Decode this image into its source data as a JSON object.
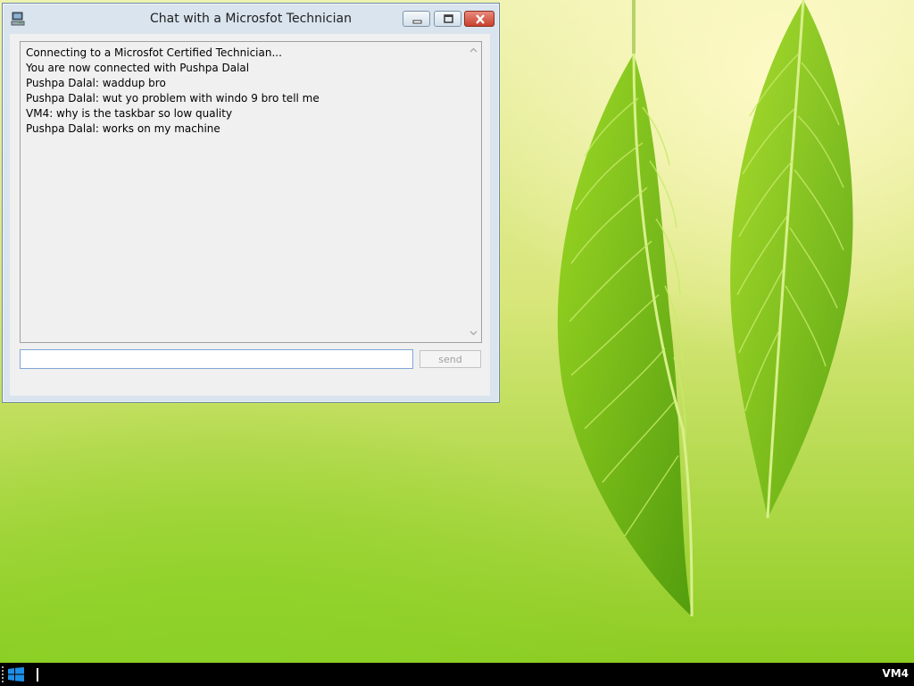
{
  "window": {
    "title": "Chat with a Microsfot Technician"
  },
  "chat": {
    "lines": [
      "Connecting to a Microsfot Certified Technician...",
      "You are now connected with Pushpa Dalal",
      "Pushpa Dalal: waddup bro",
      "Pushpa Dalal: wut yo problem with windo 9 bro tell me",
      "VM4: why is the taskbar so low quality",
      "Pushpa Dalal: works on my machine"
    ]
  },
  "composer": {
    "input_value": "",
    "send_label": "send"
  },
  "taskbar": {
    "vm_label": "VM4"
  },
  "colors": {
    "close_button": "#c8402d",
    "taskbar": "#000000",
    "input_border": "#7ea6d6"
  }
}
